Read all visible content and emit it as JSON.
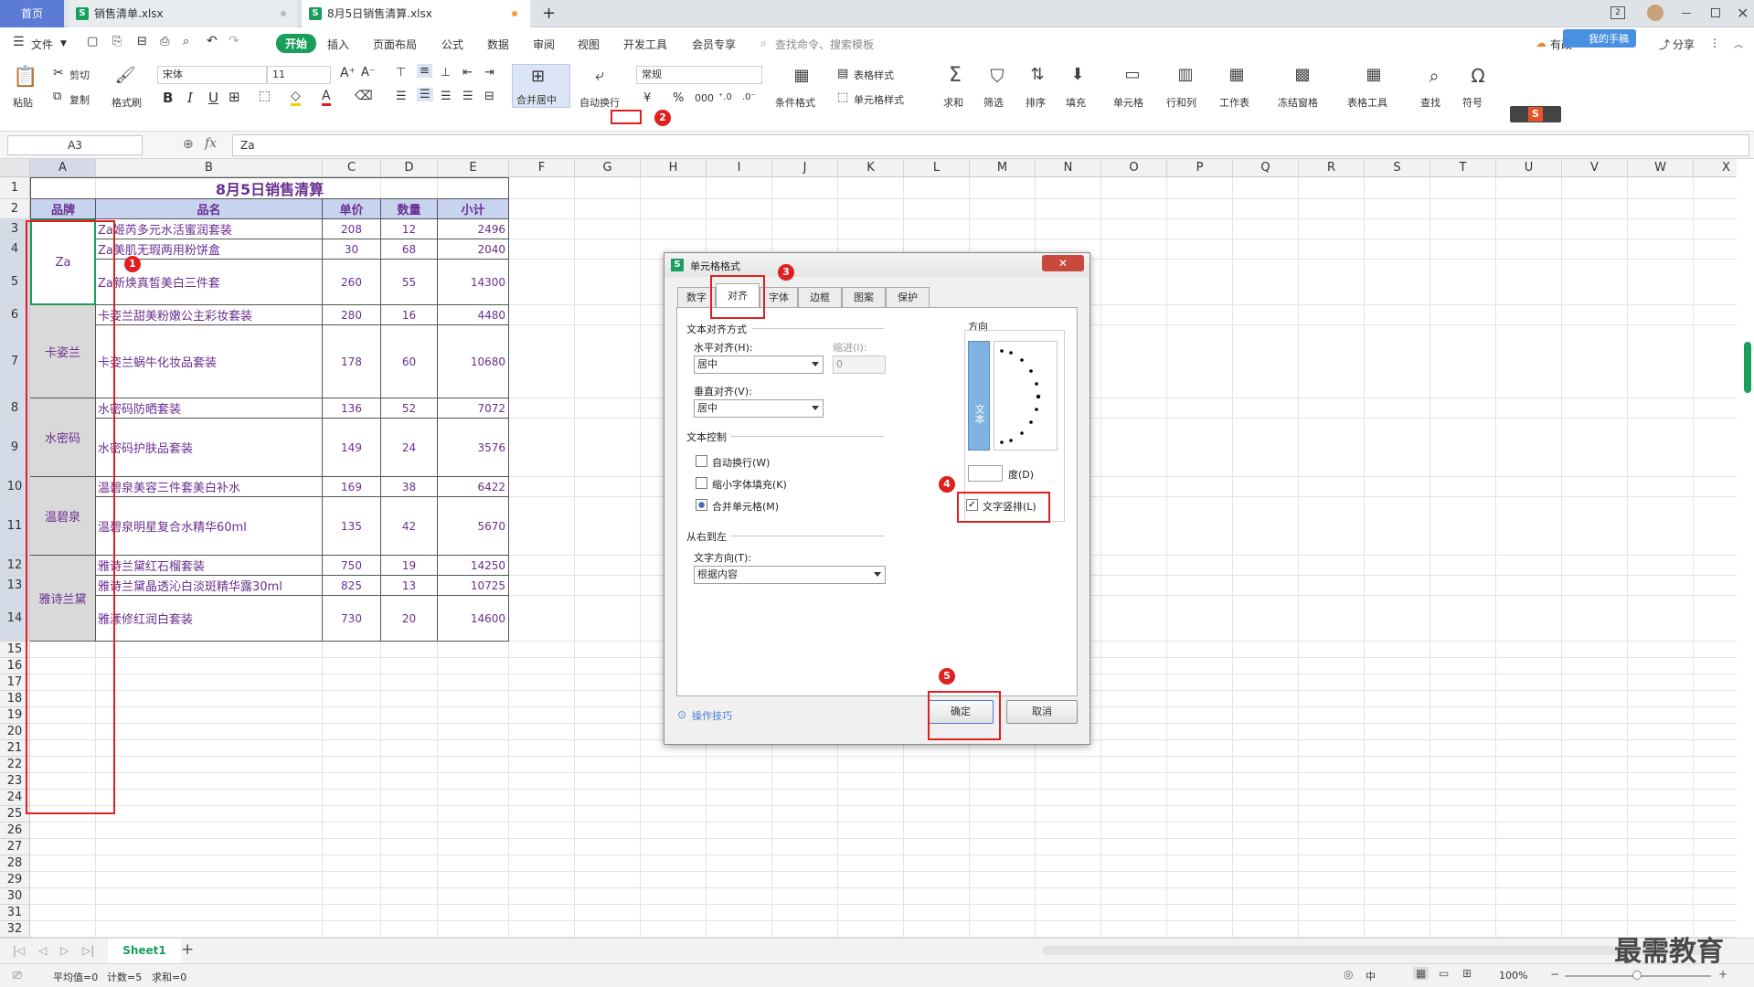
{
  "tabs": {
    "home": "首页",
    "file1": "销售清单.xlsx",
    "file2": "8月5日销售清算.xlsx",
    "new_tab": "+"
  },
  "menu": {
    "file": "文件",
    "start": "开始",
    "items": [
      "插入",
      "页面布局",
      "公式",
      "数据",
      "审阅",
      "视图",
      "开发工具",
      "会员专享"
    ],
    "search_placeholder": "查找命令、搜索模板",
    "share": "分享",
    "cloud_button": "有改",
    "wps_badge": "我的手稿"
  },
  "ribbon": {
    "paste": "粘贴",
    "cut": "剪切",
    "copy": "复制",
    "format_painter": "格式刷",
    "font_name": "宋体",
    "font_size": "11",
    "merge_center": "合并居中",
    "wrap_text": "自动换行",
    "number_format": "常规",
    "conditional_format": "条件格式",
    "table_style": "表格样式",
    "cell_style": "单元格样式",
    "sum": "求和",
    "filter": "筛选",
    "sort": "排序",
    "fill": "填充",
    "cell": "单元格",
    "row_col": "行和列",
    "worksheet": "工作表",
    "freeze": "冻结窗格",
    "table_tools": "表格工具",
    "find": "查找",
    "symbol": "符号",
    "bold": "B",
    "italic": "I",
    "underline": "U",
    "currency": "¥",
    "percent": "%",
    "thousands": "000"
  },
  "formula_bar": {
    "name_box": "A3",
    "fx": "fx",
    "content": "Za"
  },
  "sheet": {
    "columns": [
      "A",
      "B",
      "C",
      "D",
      "E",
      "F",
      "G",
      "H",
      "I",
      "J",
      "K",
      "L",
      "M",
      "N",
      "O",
      "P",
      "Q",
      "R",
      "S",
      "T",
      "U",
      "V",
      "W",
      "X"
    ],
    "title": "8月5日销售清算",
    "headers": [
      "品牌",
      "品名",
      "单价",
      "数量",
      "小计"
    ],
    "rows": [
      {
        "n": "3",
        "name": "Za姬芮多元水活蜜润套装",
        "price": "208",
        "qty": "12",
        "sub": "2496"
      },
      {
        "n": "4",
        "name": "Za美肌无瑕两用粉饼盒",
        "price": "30",
        "qty": "68",
        "sub": "2040"
      },
      {
        "n": "5",
        "name": "Za新焕真皙美白三件套",
        "price": "260",
        "qty": "55",
        "sub": "14300"
      },
      {
        "n": "6",
        "name": "卡姿兰甜美粉嫩公主彩妆套装",
        "price": "280",
        "qty": "16",
        "sub": "4480"
      },
      {
        "n": "7",
        "name": "卡姿兰蜗牛化妆品套装",
        "price": "178",
        "qty": "60",
        "sub": "10680"
      },
      {
        "n": "8",
        "name": "水密码防晒套装",
        "price": "136",
        "qty": "52",
        "sub": "7072"
      },
      {
        "n": "9",
        "name": "水密码护肤品套装",
        "price": "149",
        "qty": "24",
        "sub": "3576"
      },
      {
        "n": "10",
        "name": "温碧泉美容三件套美白补水",
        "price": "169",
        "qty": "38",
        "sub": "6422"
      },
      {
        "n": "11",
        "name": "温碧泉明星复合水精华60ml",
        "price": "135",
        "qty": "42",
        "sub": "5670"
      },
      {
        "n": "12",
        "name": "雅诗兰黛红石榴套装",
        "price": "750",
        "qty": "19",
        "sub": "14250"
      },
      {
        "n": "13",
        "name": "雅诗兰黛晶透沁白淡斑精华露30ml",
        "price": "825",
        "qty": "13",
        "sub": "10725"
      },
      {
        "n": "14",
        "name": "雅漾修红润白套装",
        "price": "730",
        "qty": "20",
        "sub": "14600"
      }
    ],
    "brands": [
      "Za",
      "卡姿兰",
      "水密码",
      "温碧泉",
      "雅诗兰黛"
    ],
    "empty_rows": [
      "15",
      "16",
      "17",
      "18",
      "19",
      "20",
      "21",
      "22",
      "23",
      "24",
      "25",
      "26",
      "27",
      "28",
      "29",
      "30",
      "31",
      "32"
    ],
    "header_row_labels": [
      "1",
      "2"
    ]
  },
  "dialog": {
    "title": "单元格格式",
    "tabs": [
      "数字",
      "对齐",
      "字体",
      "边框",
      "图案",
      "保护"
    ],
    "text_align_section": "文本对齐方式",
    "horizontal_label": "水平对齐(H):",
    "horizontal_value": "居中",
    "indent_label": "缩进(I):",
    "indent_value": "0",
    "vertical_label": "垂直对齐(V):",
    "vertical_value": "居中",
    "text_control_section": "文本控制",
    "wrap": "自动换行(W)",
    "shrink": "缩小字体填充(K)",
    "merge": "合并单元格(M)",
    "rtl_section": "从右到左",
    "text_dir_label": "文字方向(T):",
    "text_dir_value": "根据内容",
    "orientation_section": "方向",
    "vertical_text_box": "文本",
    "degree_label": "度(D)",
    "vertical_text_check": "文字竖排(L)",
    "tips": "操作技巧",
    "ok": "确定",
    "cancel": "取消"
  },
  "annotations": [
    "1",
    "2",
    "3",
    "4",
    "5"
  ],
  "bottom": {
    "sheet_tab": "Sheet1",
    "add_sheet": "+",
    "status_avg": "平均值=0",
    "status_count": "计数=5",
    "status_sum": "求和=0",
    "zoom": "100%",
    "lang": "中"
  },
  "watermark": "最需教育",
  "colors": {
    "accent_green": "#1a9e5c",
    "annotation_red": "#e02020",
    "cell_text_purple": "#6a2f90",
    "header_fill": "#c7d3ef"
  }
}
